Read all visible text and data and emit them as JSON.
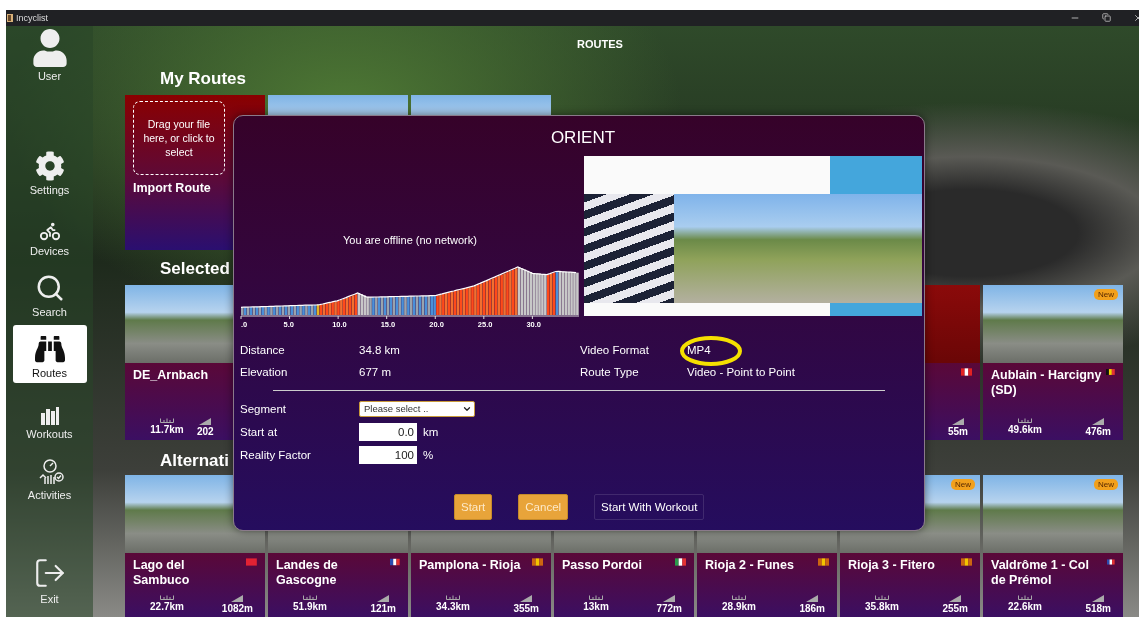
{
  "window": {
    "title": "Incyclist"
  },
  "sidebar": {
    "items": [
      {
        "label": "User",
        "selected": false
      },
      {
        "label": "Settings",
        "selected": false
      },
      {
        "label": "Devices",
        "selected": false
      },
      {
        "label": "Search",
        "selected": false
      },
      {
        "label": "Routes",
        "selected": true
      },
      {
        "label": "Workouts",
        "selected": false
      },
      {
        "label": "Activities",
        "selected": false
      },
      {
        "label": "Exit",
        "selected": false
      }
    ]
  },
  "page_title": "ROUTES",
  "sections": [
    {
      "title": "My Routes",
      "cards": [
        {
          "kind": "import",
          "text": "Drag your file here, or click to select",
          "title": "Import Route"
        },
        {
          "kind": "route"
        },
        {
          "kind": "route"
        }
      ]
    },
    {
      "title": "Selected",
      "cards": [
        {
          "kind": "route",
          "title": "DE_Arnbach",
          "distance": "11.7km",
          "elevation": "202"
        },
        {
          "kind": "covered"
        },
        {
          "kind": "covered"
        },
        {
          "kind": "covered"
        },
        {
          "kind": "covered"
        },
        {
          "kind": "route",
          "elevation": "55m"
        },
        {
          "kind": "route",
          "title": "Aublain - Harcigny (SD)",
          "badge": "New",
          "distance": "49.6km",
          "elevation": "476m"
        }
      ]
    },
    {
      "title": "Alternati",
      "cards": [
        {
          "kind": "route",
          "title": "Lago del Sambuco",
          "distance": "22.7km",
          "elevation": "1082m"
        },
        {
          "kind": "route",
          "title": "Landes de Gascogne",
          "distance": "51.9km",
          "elevation": "121m"
        },
        {
          "kind": "route",
          "title": "Pamplona - Rioja",
          "distance": "34.3km",
          "elevation": "355m"
        },
        {
          "kind": "route",
          "title": "Passo Pordoi",
          "distance": "13km",
          "elevation": "772m"
        },
        {
          "kind": "route",
          "title": "Rioja 2 - Funes",
          "distance": "28.9km",
          "elevation": "186m"
        },
        {
          "kind": "route",
          "title": "Rioja 3 - Fitero",
          "badge": "New",
          "distance": "35.8km",
          "elevation": "255m"
        },
        {
          "kind": "route",
          "title": "Valdrôme 1 - Col de Prémol",
          "badge": "New",
          "distance": "22.6km",
          "elevation": "518m"
        }
      ]
    }
  ],
  "dialog": {
    "title": "ORIENT",
    "offline_message": "You are offline (no network)",
    "profile": {
      "ticks": [
        ".0",
        "5.0",
        "10.0",
        "15.0",
        "20.0",
        "25.0",
        "30.0"
      ]
    },
    "details": [
      {
        "label": "Distance",
        "value": "34.8 km"
      },
      {
        "label": "Elevation",
        "value": "677 m"
      }
    ],
    "video_details": [
      {
        "label": "Video Format",
        "value": "MP4",
        "highlighted": true
      },
      {
        "label": "Route Type",
        "value": "Video - Point to Point",
        "highlighted": false
      }
    ],
    "form": [
      {
        "kind": "select",
        "label": "Segment",
        "value": "Please select .."
      },
      {
        "kind": "number",
        "label": "Start at",
        "value": "0.0",
        "unit": "km"
      },
      {
        "kind": "number",
        "label": "Reality Factor",
        "value": "100",
        "unit": "%"
      }
    ],
    "buttons": [
      {
        "label": "Start",
        "kind": "primary"
      },
      {
        "label": "Cancel",
        "kind": "primary"
      },
      {
        "label": "Start With Workout",
        "kind": "secondary"
      }
    ]
  }
}
